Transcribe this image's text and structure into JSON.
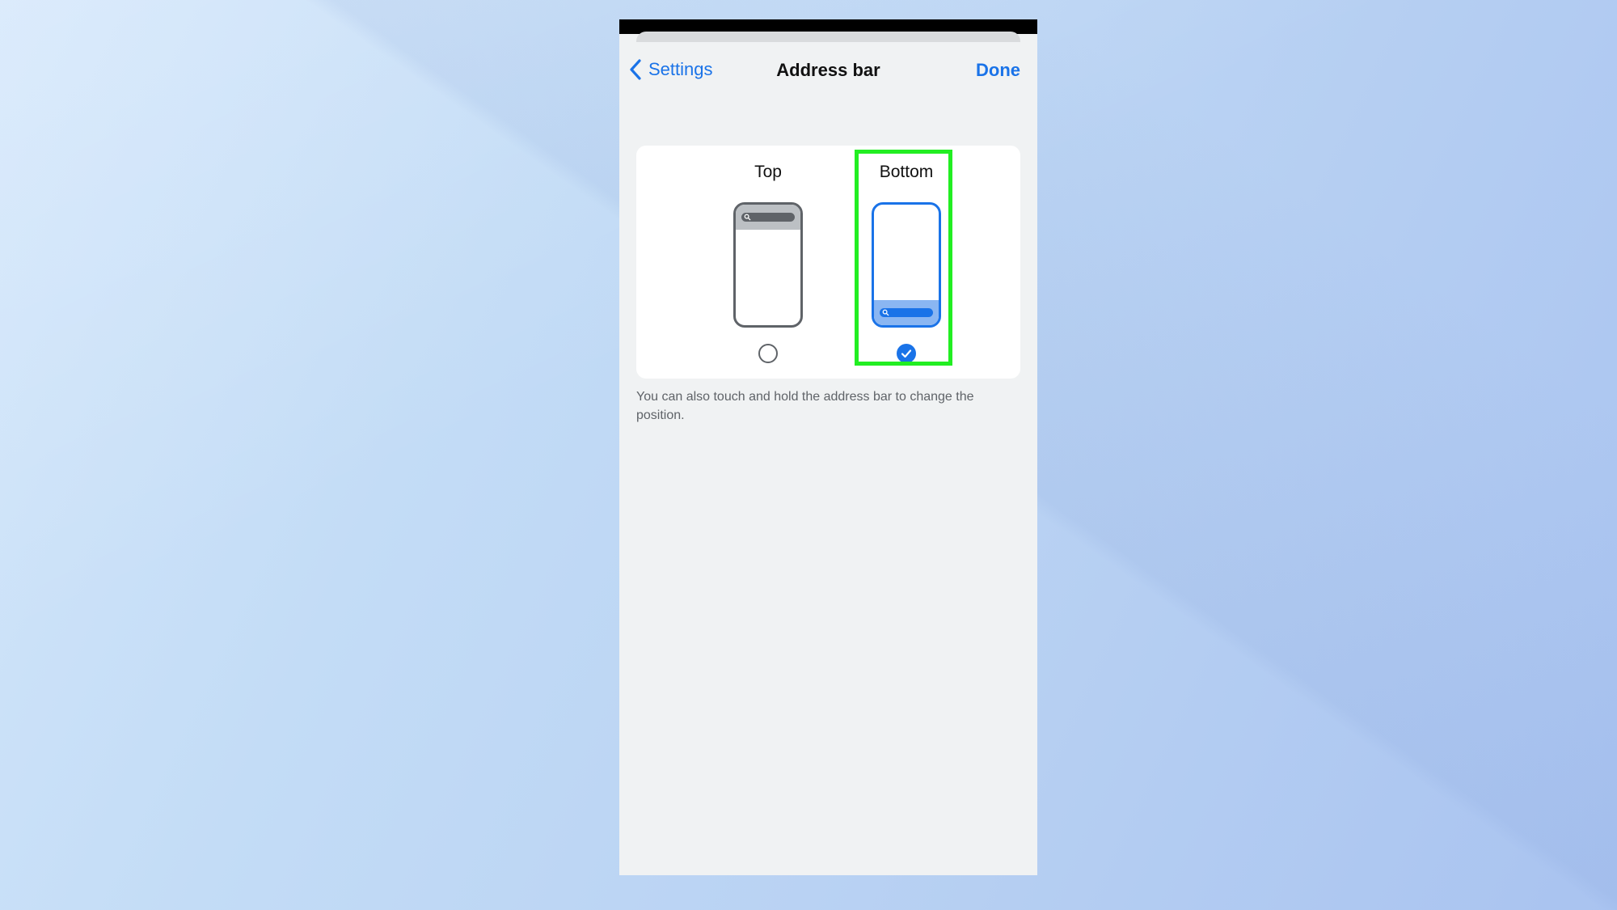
{
  "nav": {
    "back_label": "Settings",
    "title": "Address bar",
    "done_label": "Done"
  },
  "options": [
    {
      "label": "Top",
      "selected": false
    },
    {
      "label": "Bottom",
      "selected": true
    }
  ],
  "footnote": "You can also touch and hold the address bar to change the position.",
  "colors": {
    "accent": "#1a73e8",
    "highlight": "#22ee22",
    "sheet_background": "#f0f2f3"
  },
  "icons": {
    "back": "chevron-left-icon",
    "check": "checkmark-icon",
    "search": "search-icon"
  }
}
